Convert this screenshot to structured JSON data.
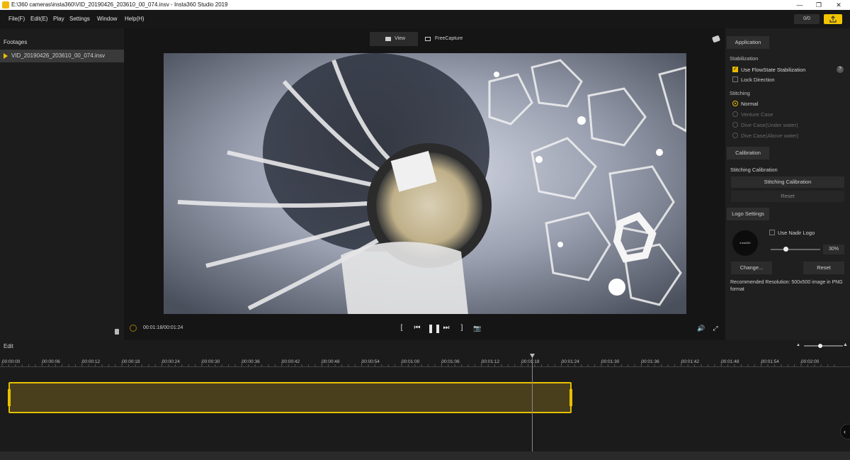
{
  "window": {
    "title": "E:\\360 cameras\\insta360\\VID_20190426_203610_00_074.insv - Insta360 Studio 2019",
    "minimize": "—",
    "maximize": "❐",
    "close": "✕"
  },
  "menu": [
    "File(F)",
    "Edit(E)",
    "Play",
    "Settings",
    "Window",
    "Help(H)"
  ],
  "counter": "0/0",
  "footage": {
    "title": "Footages",
    "items": [
      "VID_20190426_203610_00_074.insv"
    ]
  },
  "viewer": {
    "tabs": [
      "View",
      "FreeCapture"
    ],
    "timecode": "00:01:18/00:01:24"
  },
  "right_panel": {
    "application_tab": "Application",
    "stabilization_label": "Stabilization",
    "use_flowstate": "Use FlowState Stabilization",
    "use_flowstate_checked": true,
    "lock_direction": "Lock Direction",
    "lock_direction_checked": false,
    "stitching_label": "Stitching",
    "stitching_options": [
      "Normal",
      "Venture Case",
      "Dive Case(Under water)",
      "Dive Case(Above water)"
    ],
    "stitching_selected": "Normal",
    "calibration_tab": "Calibration",
    "stitching_calibration_label": "Stitching Calibration",
    "stitching_calibration_button": "Stitching Calibration",
    "calibration_reset": "Reset",
    "logo_tab": "Logo Settings",
    "use_nadir_logo": "Use Nadir Logo",
    "use_nadir_logo_checked": false,
    "logo_text": "Insta360",
    "logo_percent": "30%",
    "change_button": "Change...",
    "logo_reset": "Reset",
    "recommended": "Recommended Resolution: 500x500 image in PNG format"
  },
  "edit": {
    "label": "Edit",
    "ticks": [
      "00:00:00",
      "00:00:06",
      "00:00:12",
      "00:00:18",
      "00:00:24",
      "00:00:30",
      "00:00:36",
      "00:00:42",
      "00:00:48",
      "00:00:54",
      "00:01:00",
      "00:01:06",
      "00:01:12",
      "00:01:18",
      "00:01:24",
      "00:01:30",
      "00:01:36",
      "00:01:42",
      "00:01:48",
      "00:01:54",
      "00:02:00"
    ]
  },
  "colors": {
    "accent": "#e6c000",
    "background": "#1e1e1e"
  }
}
